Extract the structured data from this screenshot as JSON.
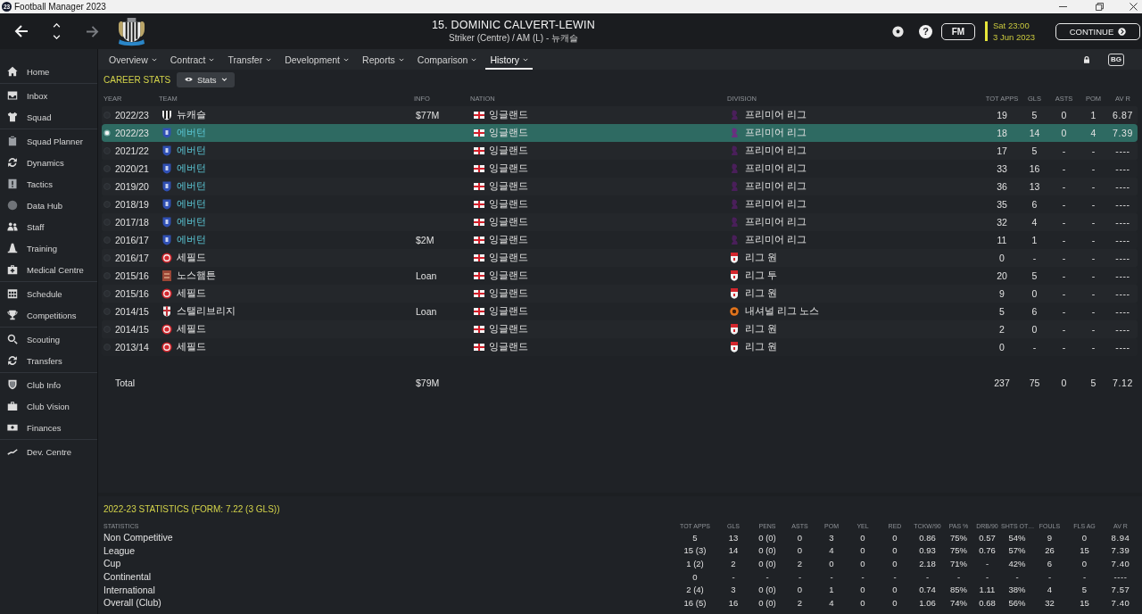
{
  "window": {
    "app_badge": "23",
    "title": "Football Manager 2023"
  },
  "header": {
    "player_title": "15. DOMINIC CALVERT-LEWIN",
    "subtitle": "Striker (Centre) / AM (L) - 뉴캐슬",
    "help_button": "?",
    "fm_button": "FM",
    "time": "Sat 23:00",
    "date": "3 Jun 2023",
    "continue_button": "CONTINUE"
  },
  "sidebar": {
    "groups": [
      {
        "items": [
          "Home"
        ]
      },
      {
        "items": [
          "Inbox",
          "Squad"
        ]
      },
      {
        "items": [
          "Squad Planner",
          "Dynamics",
          "Tactics",
          "Data Hub",
          "Staff",
          "Training",
          "Medical Centre"
        ]
      },
      {
        "items": [
          "Schedule",
          "Competitions"
        ]
      },
      {
        "items": [
          "Scouting",
          "Transfers"
        ]
      },
      {
        "items": [
          "Club Info",
          "Club Vision",
          "Finances"
        ]
      },
      {
        "items": [
          "Dev. Centre"
        ]
      }
    ]
  },
  "tabs": [
    {
      "label": "Overview",
      "selected": false
    },
    {
      "label": "Contract",
      "selected": false
    },
    {
      "label": "Transfer",
      "selected": false
    },
    {
      "label": "Development",
      "selected": false
    },
    {
      "label": "Reports",
      "selected": false
    },
    {
      "label": "Comparison",
      "selected": false
    },
    {
      "label": "History",
      "selected": true
    }
  ],
  "toolbar": {
    "bg_toggle": "BG"
  },
  "career_stats": {
    "title": "CAREER STATS",
    "view_button": "Stats",
    "columns": [
      "YEAR",
      "TEAM",
      "INFO",
      "NATION",
      "DIVISION",
      "TOT APPS",
      "GLS",
      "ASTS",
      "POM",
      "AV R"
    ],
    "rows": [
      {
        "selected": false,
        "year": "2022/23",
        "team": {
          "name": "뉴캐슬",
          "highlighted": false,
          "crest": {
            "kind": "stripes",
            "color": "#161616"
          }
        },
        "info": "$77M",
        "nation": "잉글랜드",
        "division": {
          "name": "프리미어 리그",
          "icon": {
            "kind": "badge",
            "color": "#4a1f5a"
          }
        },
        "values": [
          "19",
          "5",
          "0",
          "1",
          "6.87"
        ]
      },
      {
        "selected": true,
        "year": "2022/23",
        "team": {
          "name": "에버턴",
          "highlighted": true,
          "crest": {
            "kind": "shield",
            "color": "#3050b4"
          }
        },
        "nation": "잉글랜드",
        "division": {
          "name": "프리미어 리그",
          "icon": {
            "kind": "badge",
            "color": "#6a3080"
          }
        },
        "values": [
          "18",
          "14",
          "0",
          "4",
          "7.39"
        ]
      },
      {
        "selected": false,
        "year": "2021/22",
        "team": {
          "name": "에버턴",
          "highlighted": true,
          "crest": {
            "kind": "shield",
            "color": "#3050b4"
          }
        },
        "nation": "잉글랜드",
        "division": {
          "name": "프리미어 리그",
          "icon": {
            "kind": "badge",
            "color": "#4a1f5a"
          }
        },
        "values": [
          "17",
          "5",
          "-",
          "-",
          "----"
        ]
      },
      {
        "selected": false,
        "year": "2020/21",
        "team": {
          "name": "에버턴",
          "highlighted": true,
          "crest": {
            "kind": "shield",
            "color": "#3050b4"
          }
        },
        "nation": "잉글랜드",
        "division": {
          "name": "프리미어 리그",
          "icon": {
            "kind": "badge",
            "color": "#4a1f5a"
          }
        },
        "values": [
          "33",
          "16",
          "-",
          "-",
          "----"
        ]
      },
      {
        "selected": false,
        "year": "2019/20",
        "team": {
          "name": "에버턴",
          "highlighted": true,
          "crest": {
            "kind": "shield",
            "color": "#3050b4"
          }
        },
        "nation": "잉글랜드",
        "division": {
          "name": "프리미어 리그",
          "icon": {
            "kind": "badge",
            "color": "#4a1f5a"
          }
        },
        "values": [
          "36",
          "13",
          "-",
          "-",
          "----"
        ]
      },
      {
        "selected": false,
        "year": "2018/19",
        "team": {
          "name": "에버턴",
          "highlighted": true,
          "crest": {
            "kind": "shield",
            "color": "#3050b4"
          }
        },
        "nation": "잉글랜드",
        "division": {
          "name": "프리미어 리그",
          "icon": {
            "kind": "badge",
            "color": "#4a1f5a"
          }
        },
        "values": [
          "35",
          "6",
          "-",
          "-",
          "----"
        ]
      },
      {
        "selected": false,
        "year": "2017/18",
        "team": {
          "name": "에버턴",
          "highlighted": true,
          "crest": {
            "kind": "shield",
            "color": "#3050b4"
          }
        },
        "nation": "잉글랜드",
        "division": {
          "name": "프리미어 리그",
          "icon": {
            "kind": "badge",
            "color": "#4a1f5a"
          }
        },
        "values": [
          "32",
          "4",
          "-",
          "-",
          "----"
        ]
      },
      {
        "selected": false,
        "year": "2016/17",
        "team": {
          "name": "에버턴",
          "highlighted": true,
          "crest": {
            "kind": "shield",
            "color": "#3050b4"
          }
        },
        "info": "$2M",
        "nation": "잉글랜드",
        "division": {
          "name": "프리미어 리그",
          "icon": {
            "kind": "badge",
            "color": "#4a1f5a"
          }
        },
        "values": [
          "11",
          "1",
          "-",
          "-",
          "----"
        ]
      },
      {
        "selected": false,
        "year": "2016/17",
        "team": {
          "name": "세필드",
          "highlighted": false,
          "crest": {
            "kind": "ring",
            "color": "#d3262d"
          }
        },
        "nation": "잉글랜드",
        "division": {
          "name": "리그 원",
          "icon": {
            "kind": "shield",
            "color": "#d3262d"
          }
        },
        "values": [
          "0",
          "-",
          "-",
          "-",
          "----"
        ]
      },
      {
        "selected": false,
        "year": "2015/16",
        "team": {
          "name": "노스햄튼",
          "highlighted": false,
          "crest": {
            "kind": "square",
            "color": "#9a4636"
          }
        },
        "info": "Loan",
        "nation": "잉글랜드",
        "division": {
          "name": "리그 투",
          "icon": {
            "kind": "shield",
            "color": "#d3262d"
          }
        },
        "values": [
          "20",
          "5",
          "-",
          "-",
          "----"
        ]
      },
      {
        "selected": false,
        "year": "2015/16",
        "team": {
          "name": "세필드",
          "highlighted": false,
          "crest": {
            "kind": "ring",
            "color": "#d3262d"
          }
        },
        "nation": "잉글랜드",
        "division": {
          "name": "리그 원",
          "icon": {
            "kind": "shield",
            "color": "#d3262d"
          }
        },
        "values": [
          "9",
          "0",
          "-",
          "-",
          "----"
        ]
      },
      {
        "selected": false,
        "year": "2014/15",
        "team": {
          "name": "스탤리브리지",
          "highlighted": false,
          "crest": {
            "kind": "banner",
            "color": "#c0323a"
          }
        },
        "info": "Loan",
        "nation": "잉글랜드",
        "division": {
          "name": "내셔널 리그 노스",
          "icon": {
            "kind": "disc",
            "color": "#e2741c"
          }
        },
        "values": [
          "5",
          "6",
          "-",
          "-",
          "----"
        ]
      },
      {
        "selected": false,
        "year": "2014/15",
        "team": {
          "name": "세필드",
          "highlighted": false,
          "crest": {
            "kind": "ring",
            "color": "#d3262d"
          }
        },
        "nation": "잉글랜드",
        "division": {
          "name": "리그 원",
          "icon": {
            "kind": "shield",
            "color": "#d3262d"
          }
        },
        "values": [
          "2",
          "0",
          "-",
          "-",
          "----"
        ]
      },
      {
        "selected": false,
        "year": "2013/14",
        "team": {
          "name": "세필드",
          "highlighted": false,
          "crest": {
            "kind": "ring",
            "color": "#d3262d"
          }
        },
        "nation": "잉글랜드",
        "division": {
          "name": "리그 원",
          "icon": {
            "kind": "shield",
            "color": "#d3262d"
          }
        },
        "values": [
          "0",
          "-",
          "-",
          "-",
          "----"
        ]
      }
    ],
    "total": {
      "label": "Total",
      "info": "$79M",
      "values": [
        "237",
        "75",
        "0",
        "5",
        "7.12"
      ]
    }
  },
  "season_stats": {
    "title": "2022-23 STATISTICS (FORM: 7.22 (3 GLS))",
    "columns": [
      "STATISTICS",
      "TOT APPS",
      "GLS",
      "PENS",
      "ASTS",
      "POM",
      "YEL",
      "RED",
      "TCKW/90",
      "PAS %",
      "DRB/90",
      "SHTS OT…",
      "FOULS",
      "FLS AG",
      "AV R"
    ],
    "rows": [
      {
        "label": "Non Competitive",
        "values": [
          "5",
          "13",
          "0 (0)",
          "0",
          "3",
          "0",
          "0",
          "0.86",
          "75%",
          "0.57",
          "54%",
          "9",
          "0",
          "8.94"
        ]
      },
      {
        "label": "League",
        "values": [
          "15 (3)",
          "14",
          "0 (0)",
          "0",
          "4",
          "0",
          "0",
          "0.93",
          "75%",
          "0.76",
          "57%",
          "26",
          "15",
          "7.39"
        ]
      },
      {
        "label": "Cup",
        "values": [
          "1 (2)",
          "2",
          "0 (0)",
          "2",
          "0",
          "0",
          "0",
          "2.18",
          "71%",
          "-",
          "42%",
          "6",
          "0",
          "7.40"
        ]
      },
      {
        "label": "Continental",
        "values": [
          "0",
          "-",
          "-",
          "-",
          "-",
          "-",
          "-",
          "-",
          "-",
          "-",
          "-",
          "-",
          "-",
          "----"
        ]
      },
      {
        "label": "International",
        "values": [
          "2 (4)",
          "3",
          "0 (0)",
          "0",
          "1",
          "0",
          "0",
          "0.74",
          "85%",
          "1.11",
          "38%",
          "4",
          "5",
          "7.57"
        ]
      },
      {
        "label": "Overall (Club)",
        "values": [
          "16 (5)",
          "16",
          "0 (0)",
          "2",
          "4",
          "0",
          "0",
          "1.06",
          "74%",
          "0.68",
          "56%",
          "32",
          "15",
          "7.40"
        ]
      }
    ]
  }
}
